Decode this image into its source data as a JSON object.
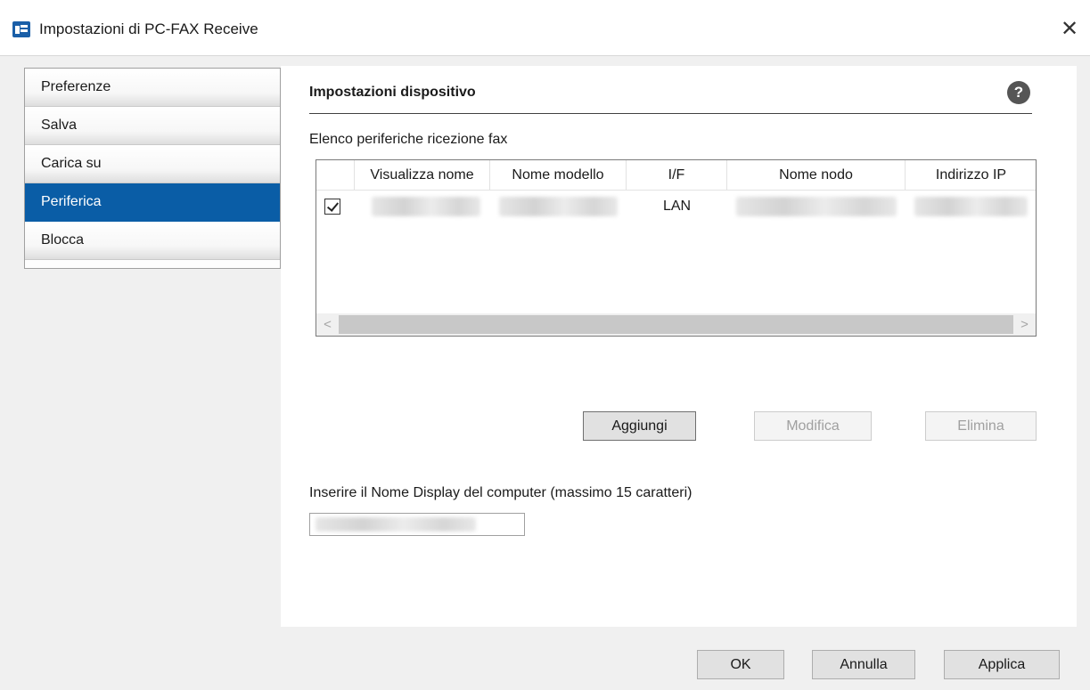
{
  "window": {
    "title": "Impostazioni di PC-FAX Receive",
    "close_glyph": "✕",
    "icon": "pcfax-app-icon"
  },
  "sidebar": {
    "items": [
      {
        "label": "Preferenze",
        "active": false
      },
      {
        "label": "Salva",
        "active": false
      },
      {
        "label": "Carica su",
        "active": false
      },
      {
        "label": "Periferica",
        "active": true
      },
      {
        "label": "Blocca",
        "active": false
      }
    ]
  },
  "panel": {
    "section_title": "Impostazioni dispositivo",
    "help_glyph": "?",
    "list_label": "Elenco periferiche ricezione fax",
    "columns": [
      "",
      "Visualizza nome",
      "Nome modello",
      "I/F",
      "Nome nodo",
      "Indirizzo IP"
    ],
    "rows": [
      {
        "checked": true,
        "display_name": "",
        "model_name": "",
        "interface": "LAN",
        "node_name": "",
        "ip_address": ""
      }
    ],
    "scroll_left_glyph": "<",
    "scroll_right_glyph": ">",
    "buttons": {
      "add": "Aggiungi",
      "edit": "Modifica",
      "delete": "Elimina"
    },
    "computer_name_label": "Inserire il Nome Display del computer (massimo 15 caratteri)",
    "computer_name_value": ""
  },
  "footer": {
    "ok": "OK",
    "cancel": "Annulla",
    "apply": "Applica"
  },
  "colors": {
    "accent": "#0a5da6",
    "dialog_bg": "#f0f0f0",
    "panel_bg": "#ffffff"
  }
}
